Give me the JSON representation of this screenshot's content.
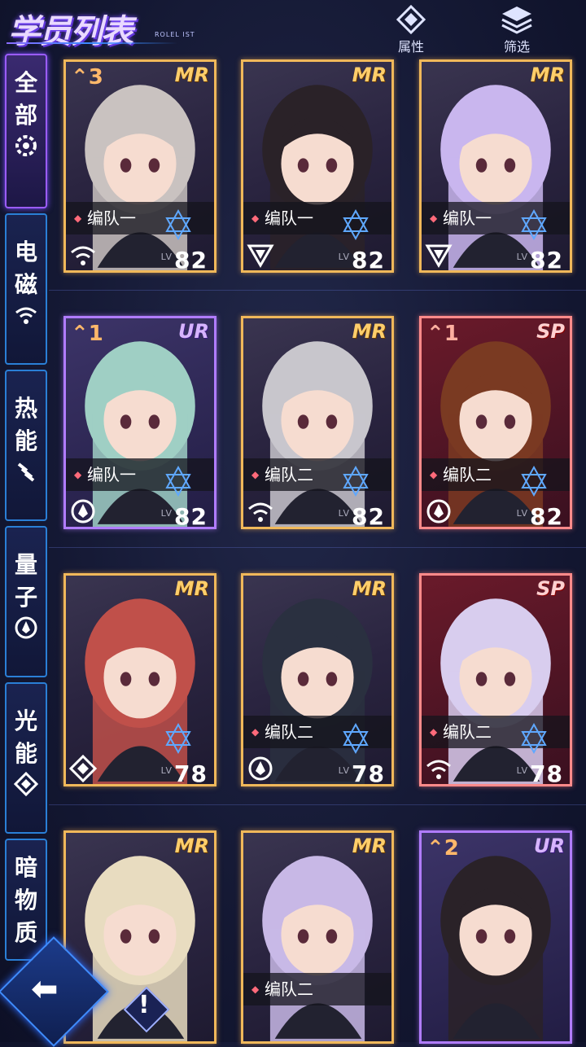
{
  "header": {
    "title": "学员列表",
    "subtitle": "ROLEL IST",
    "attr_label": "属性",
    "filter_label": "筛选"
  },
  "sidebar": {
    "items": [
      {
        "label_1": "全",
        "label_2": "部",
        "icon": "gear-icon",
        "active": true
      },
      {
        "label_1": "电",
        "label_2": "磁",
        "icon": "wifi-icon",
        "active": false
      },
      {
        "label_1": "热",
        "label_2": "能",
        "icon": "heat-icon",
        "active": false
      },
      {
        "label_1": "量",
        "label_2": "子",
        "icon": "quantum-icon",
        "active": false
      },
      {
        "label_1": "光",
        "label_2": "能",
        "icon": "diamond-icon",
        "active": false
      },
      {
        "label_1": "暗",
        "label_2": "物",
        "label_3": "质",
        "icon": "triangle-icon",
        "active": false
      }
    ]
  },
  "cards": [
    {
      "rank": "MR",
      "stars": "⌃3",
      "squad": "编队一",
      "level": "82",
      "lv": "LV",
      "element": "wifi-icon",
      "tier": "mr"
    },
    {
      "rank": "MR",
      "stars": "",
      "squad": "编队一",
      "level": "82",
      "lv": "LV",
      "element": "triangle-icon",
      "tier": "mr"
    },
    {
      "rank": "MR",
      "stars": "",
      "squad": "编队一",
      "level": "82",
      "lv": "LV",
      "element": "triangle-icon",
      "tier": "mr"
    },
    {
      "rank": "UR",
      "stars": "⌃1",
      "squad": "编队一",
      "level": "82",
      "lv": "LV",
      "element": "quantum-icon",
      "tier": "ur"
    },
    {
      "rank": "MR",
      "stars": "",
      "squad": "编队二",
      "level": "82",
      "lv": "LV",
      "element": "wifi-icon",
      "tier": "mr"
    },
    {
      "rank": "SP",
      "stars": "⌃1",
      "squad": "编队二",
      "level": "82",
      "lv": "LV",
      "element": "quantum-icon",
      "tier": "sp"
    },
    {
      "rank": "MR",
      "stars": "",
      "squad": "",
      "level": "78",
      "lv": "LV",
      "element": "diamond-icon",
      "tier": "mr"
    },
    {
      "rank": "MR",
      "stars": "",
      "squad": "编队二",
      "level": "78",
      "lv": "LV",
      "element": "quantum-icon",
      "tier": "mr"
    },
    {
      "rank": "SP",
      "stars": "",
      "squad": "编队二",
      "level": "78",
      "lv": "LV",
      "element": "wifi-icon",
      "tier": "sp"
    },
    {
      "rank": "MR",
      "stars": "",
      "squad": "",
      "level": "",
      "lv": "",
      "element": "",
      "tier": "mr"
    },
    {
      "rank": "MR",
      "stars": "",
      "squad": "编队二",
      "level": "",
      "lv": "",
      "element": "",
      "tier": "mr"
    },
    {
      "rank": "UR",
      "stars": "⌃2",
      "squad": "",
      "level": "",
      "lv": "",
      "element": "",
      "tier": "ur"
    }
  ],
  "colors": {
    "mr": "#f0b85a",
    "ur": "#b07cff",
    "sp": "#ff8a8a",
    "accent": "#2a7fd6"
  }
}
